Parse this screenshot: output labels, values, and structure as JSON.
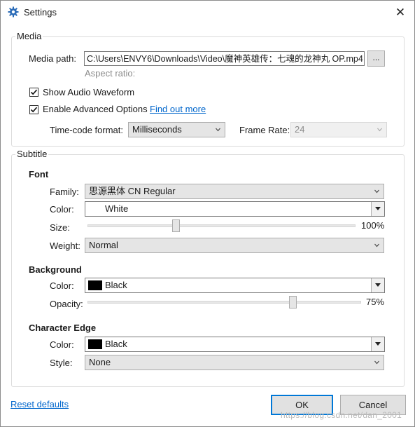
{
  "window": {
    "title": "Settings",
    "close_glyph": "✕",
    "title_icon": "gear-icon"
  },
  "media": {
    "legend": "Media",
    "path_label": "Media path:",
    "path_value": "C:\\Users\\ENVY6\\Downloads\\Video\\魔神英雄传：七魂的龙神丸 OP.mp4",
    "browse_label": "...",
    "aspect_ratio_label": "Aspect ratio:",
    "show_waveform_label": "Show Audio Waveform",
    "show_waveform_checked": true,
    "advanced_label": "Enable Advanced Options",
    "advanced_checked": true,
    "find_out_more": "Find out more",
    "timecode_label": "Time-code format:",
    "timecode_value": "Milliseconds",
    "framerate_label": "Frame Rate:",
    "framerate_value": "24"
  },
  "subtitle": {
    "legend": "Subtitle",
    "font": {
      "heading": "Font",
      "family_label": "Family:",
      "family_value": "思源黑体 CN Regular",
      "color_label": "Color:",
      "color_value": "White",
      "color_hex": "#ffffff",
      "size_label": "Size:",
      "size_value": "100%",
      "size_fraction": 0.33,
      "weight_label": "Weight:",
      "weight_value": "Normal"
    },
    "background": {
      "heading": "Background",
      "color_label": "Color:",
      "color_value": "Black",
      "color_hex": "#000000",
      "opacity_label": "Opacity:",
      "opacity_value": "75%",
      "opacity_fraction": 0.75
    },
    "edge": {
      "heading": "Character Edge",
      "color_label": "Color:",
      "color_value": "Black",
      "color_hex": "#000000",
      "style_label": "Style:",
      "style_value": "None"
    }
  },
  "footer": {
    "reset_label": "Reset defaults",
    "ok_label": "OK",
    "cancel_label": "Cancel",
    "watermark": "https://blog.csdn.net/dan_2001"
  },
  "colors": {
    "link": "#0066cc",
    "accent": "#0078d7"
  }
}
